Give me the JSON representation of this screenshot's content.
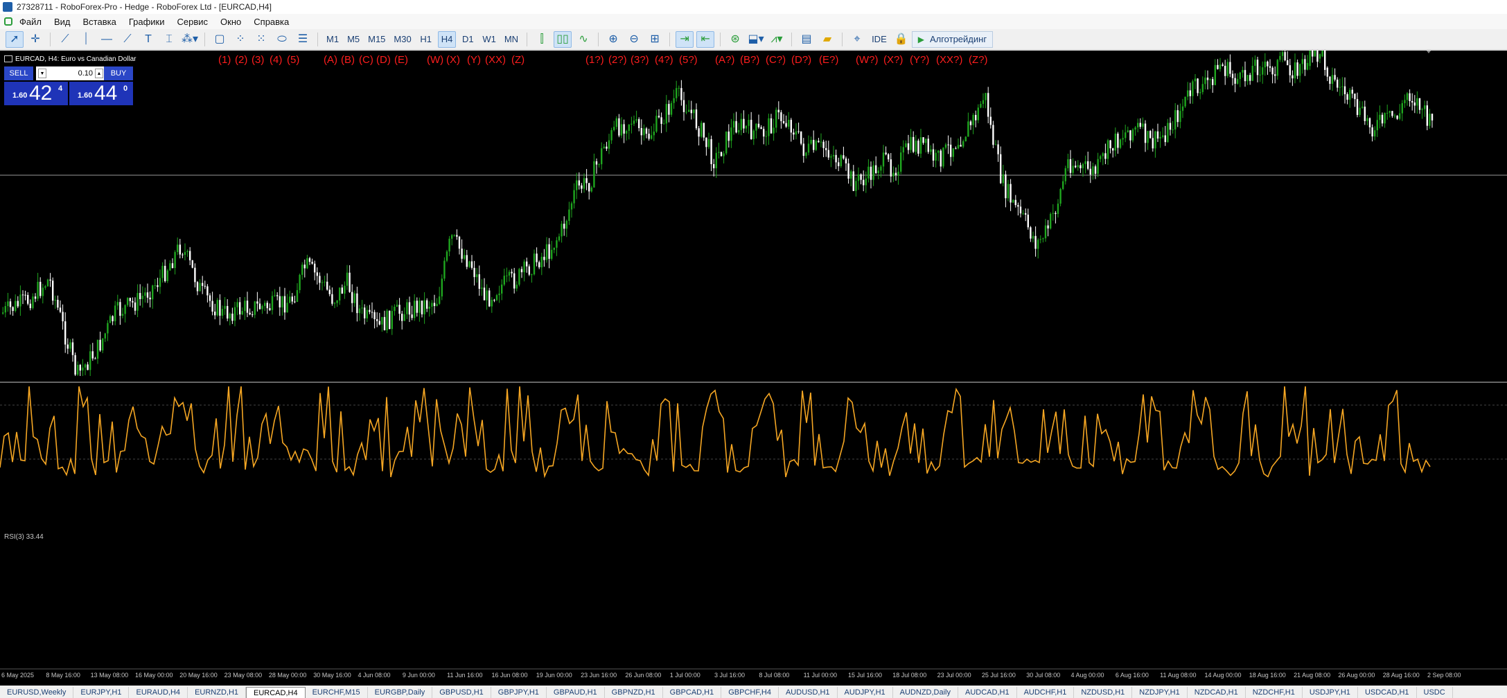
{
  "window": {
    "title": "27328711 - RoboForex-Pro - Hedge - RoboForex Ltd - [EURCAD,H4]"
  },
  "menu": {
    "items": [
      "Файл",
      "Вид",
      "Вставка",
      "Графики",
      "Сервис",
      "Окно",
      "Справка"
    ]
  },
  "toolbar": {
    "timeframes": [
      "M1",
      "M5",
      "M15",
      "M30",
      "H1",
      "H4",
      "D1",
      "W1",
      "MN"
    ],
    "active_timeframe": "H4",
    "ide_label": "IDE",
    "algo_label": "Алготрейдинг"
  },
  "chart": {
    "header": "EURCAD, H4:  Euro vs Canadian Dollar",
    "trade": {
      "sell_label": "SELL",
      "buy_label": "BUY",
      "lot": "0.10",
      "sell_small": "1.60",
      "sell_big": "42",
      "sell_sup": "4",
      "buy_small": "1.60",
      "buy_big": "44",
      "buy_sup": "0"
    },
    "wave_labels": [
      "(1)",
      "(2)",
      "(3)",
      "(4)",
      "(5)",
      "(A)",
      "(B)",
      "(C)",
      "(D)",
      "(E)",
      "(W)",
      "(X)",
      "(Y)",
      "(XX)",
      "(Z)",
      "(1?)",
      "(2?)",
      "(3?)",
      "(4?)",
      "(5?)",
      "(A?)",
      "(B?)",
      "(C?)",
      "(D?)",
      "(E?)",
      "(W?)",
      "(X?)",
      "(Y?)",
      "(XX?)",
      "(Z?)"
    ],
    "rsi_label": "RSI(3) 33.44",
    "time_axis": [
      "6 May 2025",
      "8 May 16:00",
      "13 May 08:00",
      "16 May 00:00",
      "20 May 16:00",
      "23 May 08:00",
      "28 May 00:00",
      "30 May 16:00",
      "4 Jun 08:00",
      "9 Jun 00:00",
      "11 Jun 16:00",
      "16 Jun 08:00",
      "19 Jun 00:00",
      "23 Jun 16:00",
      "26 Jun 08:00",
      "1 Jul 00:00",
      "3 Jul 16:00",
      "8 Jul 08:00",
      "11 Jul 00:00",
      "15 Jul 16:00",
      "18 Jul 08:00",
      "23 Jul 00:00",
      "25 Jul 16:00",
      "30 Jul 08:00",
      "4 Aug 00:00",
      "6 Aug 16:00",
      "11 Aug 08:00",
      "14 Aug 00:00",
      "18 Aug 16:00",
      "21 Aug 08:00",
      "26 Aug 00:00",
      "28 Aug 16:00",
      "2 Sep 08:00"
    ],
    "bull_color": "#1fa61f",
    "bear_color": "#ffffff",
    "rsi_color": "#f5a623"
  },
  "tabs": {
    "items": [
      "EURUSD,Weekly",
      "EURJPY,H1",
      "EURAUD,H4",
      "EURNZD,H1",
      "EURCAD,H4",
      "EURCHF,M15",
      "EURGBP,Daily",
      "GBPUSD,H1",
      "GBPJPY,H1",
      "GBPAUD,H1",
      "GBPNZD,H1",
      "GBPCAD,H1",
      "GBPCHF,H4",
      "AUDUSD,H1",
      "AUDJPY,H1",
      "AUDNZD,Daily",
      "AUDCAD,H1",
      "AUDCHF,H1",
      "NZDUSD,H1",
      "NZDJPY,H1",
      "NZDCAD,H1",
      "NZDCHF,H1",
      "USDJPY,H1",
      "USDCAD,H1",
      "USDC"
    ],
    "active": "EURCAD,H4"
  }
}
